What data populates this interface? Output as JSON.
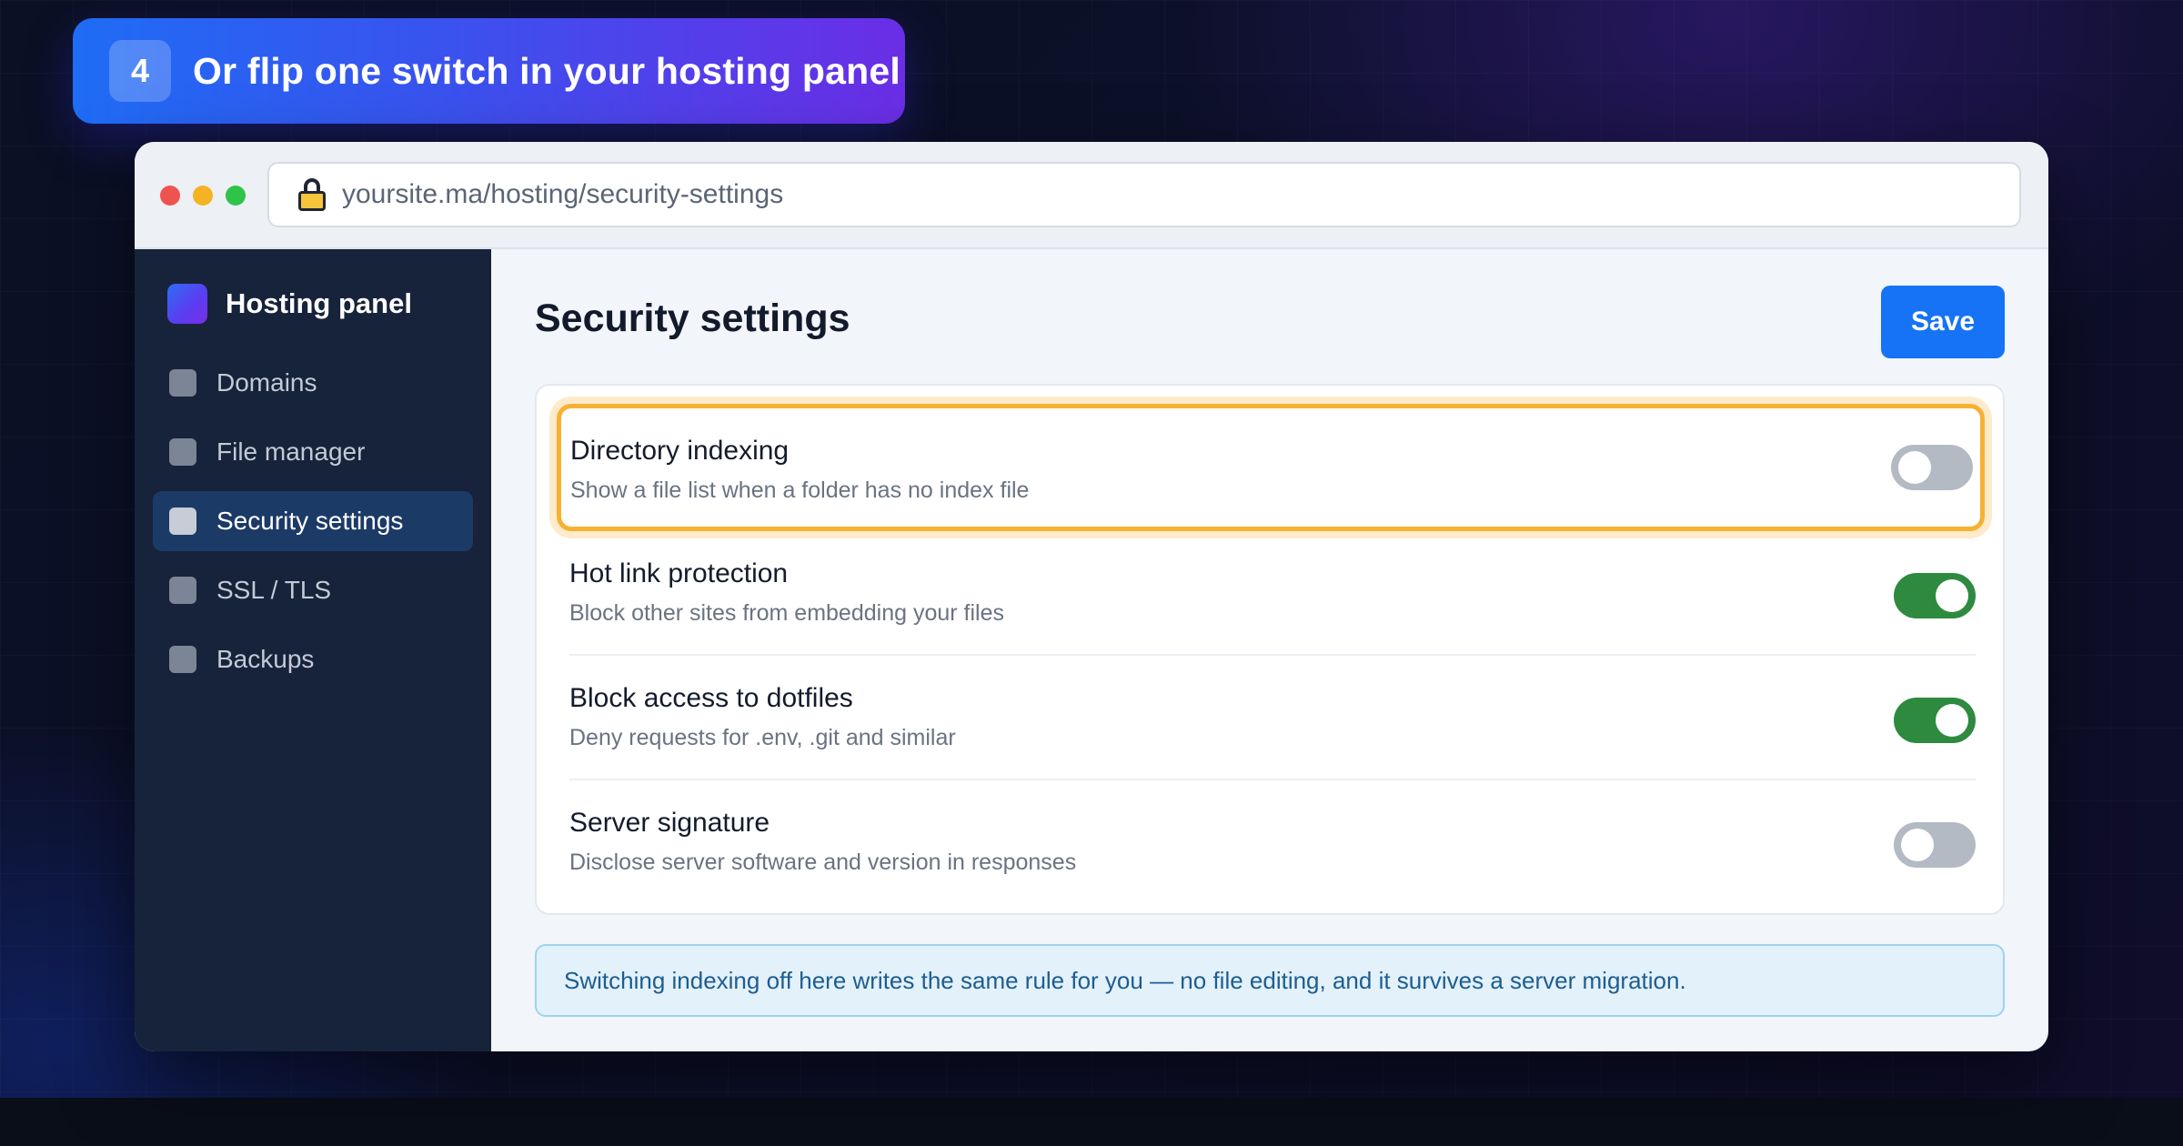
{
  "step": {
    "number": "4",
    "title": "Or flip one switch in your hosting panel"
  },
  "browser": {
    "url": "yoursite.ma/hosting/security-settings",
    "icons": [
      "lock-icon"
    ]
  },
  "sidebar": {
    "brand": "Hosting panel",
    "items": [
      {
        "label": "Domains",
        "active": false
      },
      {
        "label": "File manager",
        "active": false
      },
      {
        "label": "Security settings",
        "active": true
      },
      {
        "label": "SSL / TLS",
        "active": false
      },
      {
        "label": "Backups",
        "active": false
      }
    ]
  },
  "main": {
    "title": "Security settings",
    "save_label": "Save",
    "settings": [
      {
        "title": "Directory indexing",
        "description": "Show a file list when a folder has no index file",
        "enabled": false,
        "highlighted": true
      },
      {
        "title": "Hot link protection",
        "description": "Block other sites from embedding your files",
        "enabled": true,
        "highlighted": false
      },
      {
        "title": "Block access to dotfiles",
        "description": "Deny requests for .env, .git and similar",
        "enabled": true,
        "highlighted": false
      },
      {
        "title": "Server signature",
        "description": "Disclose server software and version in responses",
        "enabled": false,
        "highlighted": false
      }
    ],
    "note": "Switching indexing off here writes the same rule for you — no file editing, and it survives a server migration."
  },
  "colors": {
    "accent": "#1673f5",
    "toggle_on": "#2d8a3f",
    "toggle_off": "#b4bac4",
    "highlight": "#f7b131",
    "sidebar_bg": "#17233b"
  }
}
